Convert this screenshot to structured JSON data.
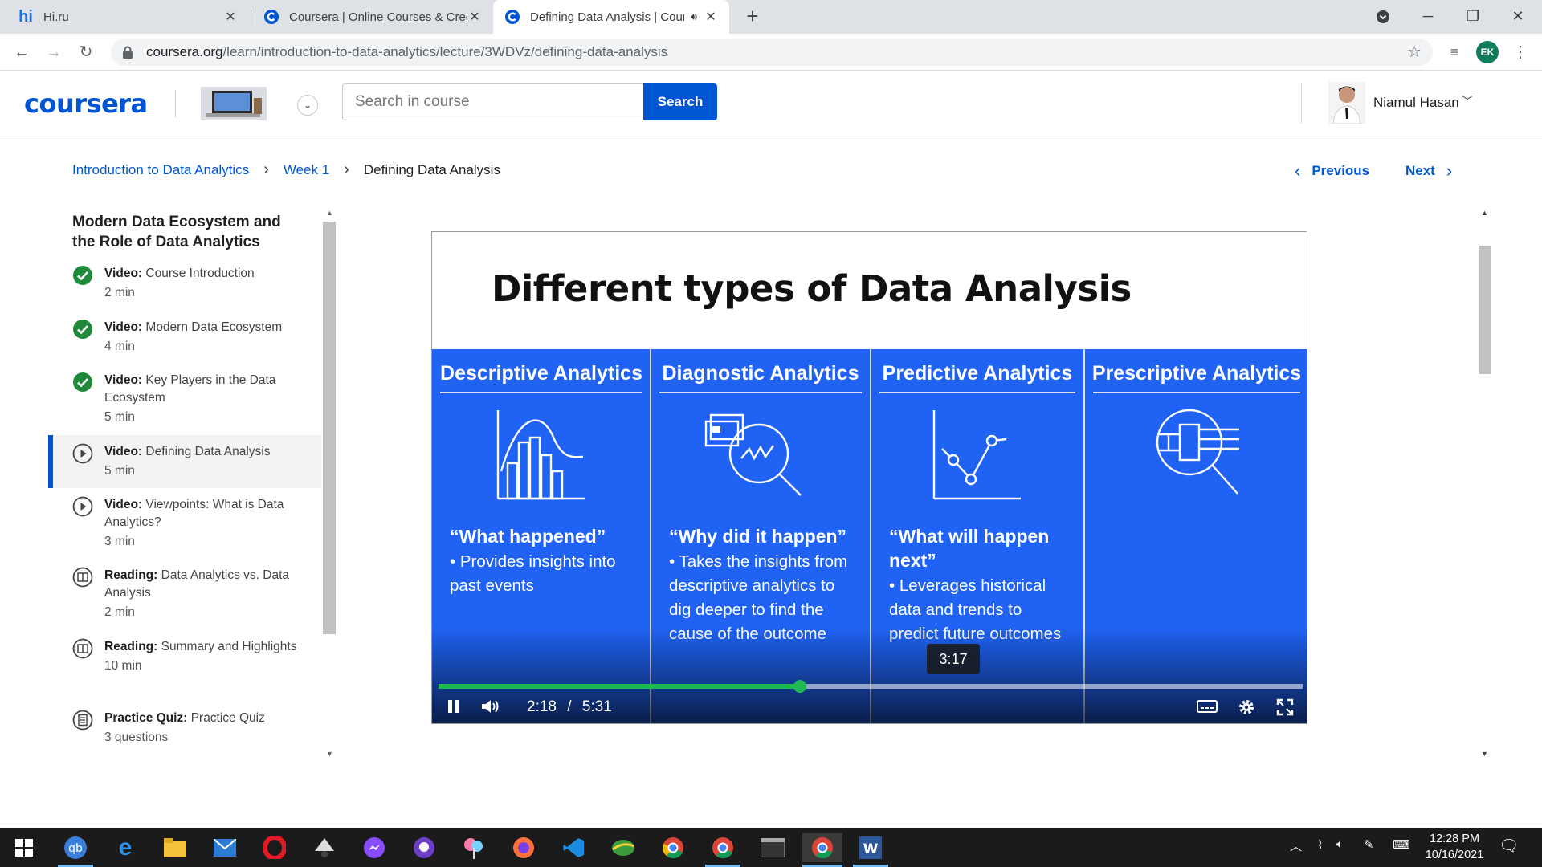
{
  "browser": {
    "tabs": [
      {
        "title": "Hi.ru",
        "favicon": "hi",
        "active": false
      },
      {
        "title": "Coursera | Online Courses & Credentials",
        "favicon": "coursera-c",
        "active": false
      },
      {
        "title": "Defining Data Analysis | Coursera",
        "favicon": "coursera-c",
        "active": true,
        "audio": true
      }
    ],
    "url_host": "coursera.org",
    "url_path": "/learn/introduction-to-data-analytics/lecture/3WDVz/defining-data-analysis",
    "profile_initials": "EK"
  },
  "header": {
    "logo": "coursera",
    "search_placeholder": "Search in course",
    "search_button": "Search",
    "user_name": "Niamul Hasan"
  },
  "breadcrumb": {
    "course": "Introduction to Data Analytics",
    "week": "Week 1",
    "current": "Defining Data Analysis"
  },
  "nav": {
    "previous": "Previous",
    "next": "Next"
  },
  "sidebar": {
    "module_title": "Modern Data Ecosystem and the Role of Data Analytics",
    "items": [
      {
        "type": "Video:",
        "title": "Course Introduction",
        "duration": "2 min",
        "status": "completed",
        "icon": "check-icon"
      },
      {
        "type": "Video:",
        "title": "Modern Data Ecosystem",
        "duration": "4 min",
        "status": "completed",
        "icon": "check-icon"
      },
      {
        "type": "Video:",
        "title": "Key Players in the Data Ecosystem",
        "duration": "5 min",
        "status": "completed",
        "icon": "check-icon"
      },
      {
        "type": "Video:",
        "title": "Defining Data Analysis",
        "duration": "5 min",
        "status": "active",
        "icon": "play-icon"
      },
      {
        "type": "Video:",
        "title": "Viewpoints: What is Data Analytics?",
        "duration": "3 min",
        "status": "pending",
        "icon": "play-icon"
      },
      {
        "type": "Reading:",
        "title": "Data Analytics vs. Data Analysis",
        "duration": "2 min",
        "status": "pending",
        "icon": "book-icon"
      },
      {
        "type": "Reading:",
        "title": "Summary and Highlights",
        "duration": "10 min",
        "status": "pending",
        "icon": "book-icon"
      },
      {
        "type": "Practice Quiz:",
        "title": "Practice Quiz",
        "duration": "3 questions",
        "status": "pending",
        "icon": "quiz-icon"
      }
    ]
  },
  "video": {
    "slide_title": "Different types of Data Analysis",
    "columns": [
      {
        "heading": "Descriptive Analytics",
        "question": "“What happened”",
        "bullet": "• Provides insights into past events",
        "icon": "histogram-icon"
      },
      {
        "heading": "Diagnostic Analytics",
        "question": "“Why did it happen”",
        "bullet": "• Takes the insights from descriptive analytics to dig deeper to find the cause of the outcome",
        "icon": "magnifier-chart-icon"
      },
      {
        "heading": "Predictive Analytics",
        "question": "“What will happen next”",
        "bullet": "• Leverages historical data and trends to predict future outcomes",
        "icon": "line-chart-icon"
      },
      {
        "heading": "Prescriptive Analytics",
        "question": "",
        "bullet": "",
        "icon": "circuit-magnifier-icon"
      }
    ],
    "hover_time": "3:17",
    "current_time": "2:18",
    "time_separator": "/",
    "duration": "5:31",
    "progress_fraction": 0.418,
    "progress_color": "#1db954"
  },
  "taskbar": {
    "apps": [
      "start",
      "qbittorrent",
      "edge",
      "file-explorer",
      "mail",
      "opera",
      "inkscape",
      "messenger",
      "github-desktop",
      "pinwheel",
      "firefox",
      "vscode",
      "earth",
      "chrome",
      "chrome-alt",
      "terminal",
      "chrome-ek",
      "word"
    ],
    "time": "12:28 PM",
    "date": "10/16/2021"
  },
  "colors": {
    "brand": "#0056d2",
    "slide_blue": "#1f62f4",
    "complete_green": "#1e8a3a"
  }
}
